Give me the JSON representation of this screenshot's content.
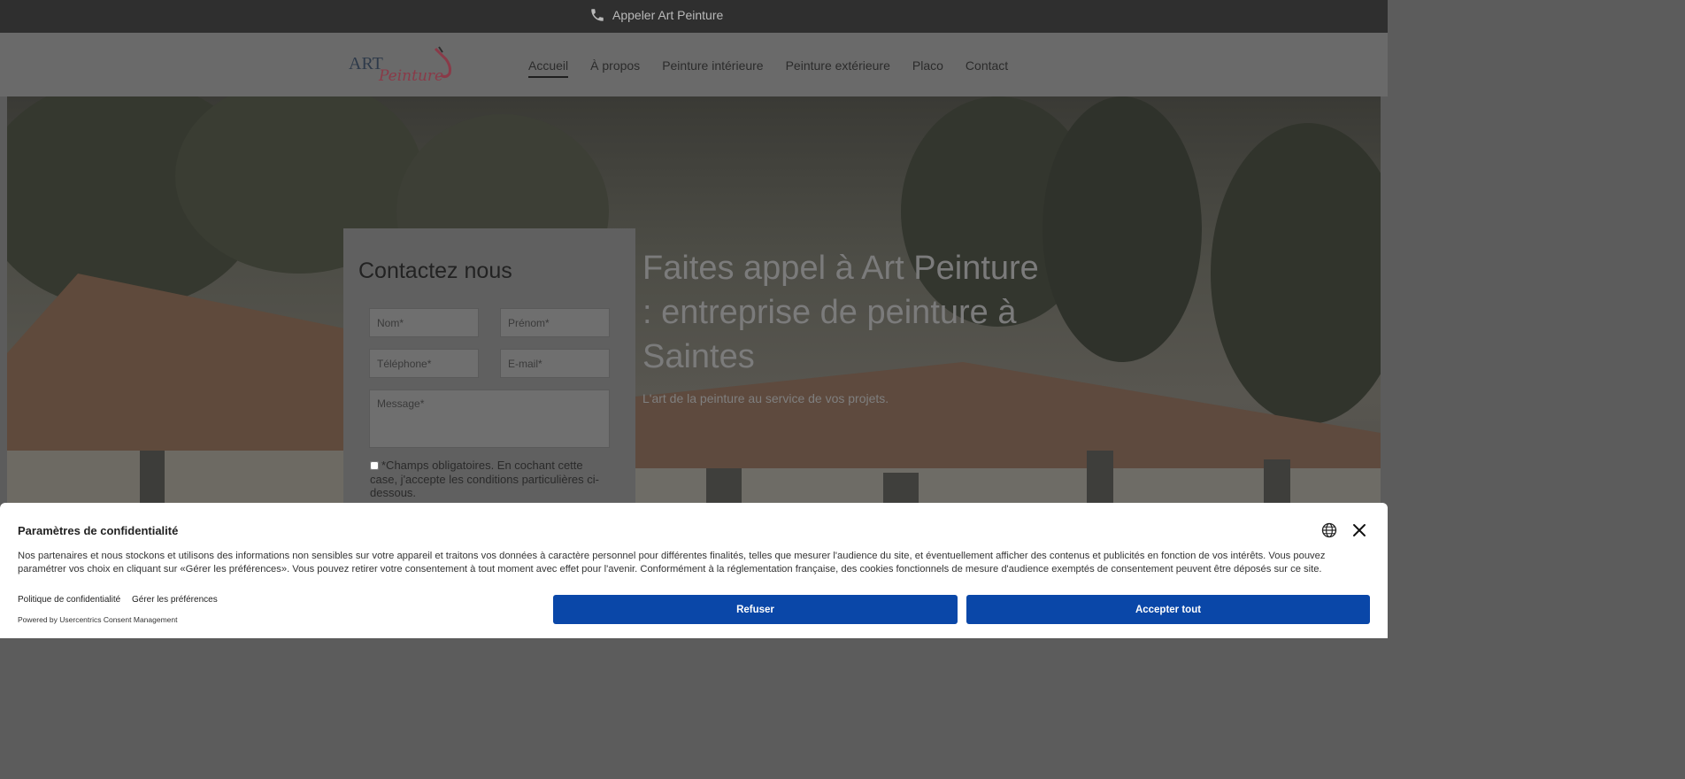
{
  "topbar": {
    "call_label": "Appeler Art Peinture"
  },
  "header": {
    "logo_text_main": "ART",
    "logo_text_script": "Peinture",
    "nav": [
      {
        "label": "Accueil",
        "active": true
      },
      {
        "label": "À propos"
      },
      {
        "label": "Peinture intérieure"
      },
      {
        "label": "Peinture extérieure"
      },
      {
        "label": "Placo"
      },
      {
        "label": "Contact"
      }
    ]
  },
  "contact_form": {
    "title": "Contactez nous",
    "nom_placeholder": "Nom*",
    "prenom_placeholder": "Prénom*",
    "telephone_placeholder": "Téléphone*",
    "email_placeholder": "E-mail*",
    "message_placeholder": "Message*",
    "consent_text": "*Champs obligatoires. En cochant cette case, j'accepte les conditions particulières ci-dessous."
  },
  "hero": {
    "headline": "Faites appel à Art Peinture : entreprise de peinture à Saintes",
    "tagline": "L'art de la peinture au service de vos projets."
  },
  "cookie": {
    "title": "Paramètres de confidentialité",
    "body": "Nos partenaires et nous stockons et utilisons des informations non sensibles sur votre appareil et traitons vos données à caractère personnel pour différentes finalités, telles que mesurer l'audience du site, et éventuellement afficher des contenus et publicités en fonction de vos intérêts. Vous pouvez paramétrer vos choix en cliquant sur «Gérer les préférences». Vous pouvez retirer votre consentement à tout moment avec effet pour l'avenir. Conformément à la réglementation française, des cookies fonctionnels de mesure d'audience exemptés de consentement peuvent être déposés sur ce site.",
    "privacy_link": "Politique de confidentialité",
    "prefs_link": "Gérer les préférences",
    "powered": "Powered by Usercentrics Consent Management",
    "refuse_label": "Refuser",
    "accept_label": "Accepter tout"
  },
  "colors": {
    "accent": "#0a47a8",
    "logo_red": "#c4475a"
  }
}
